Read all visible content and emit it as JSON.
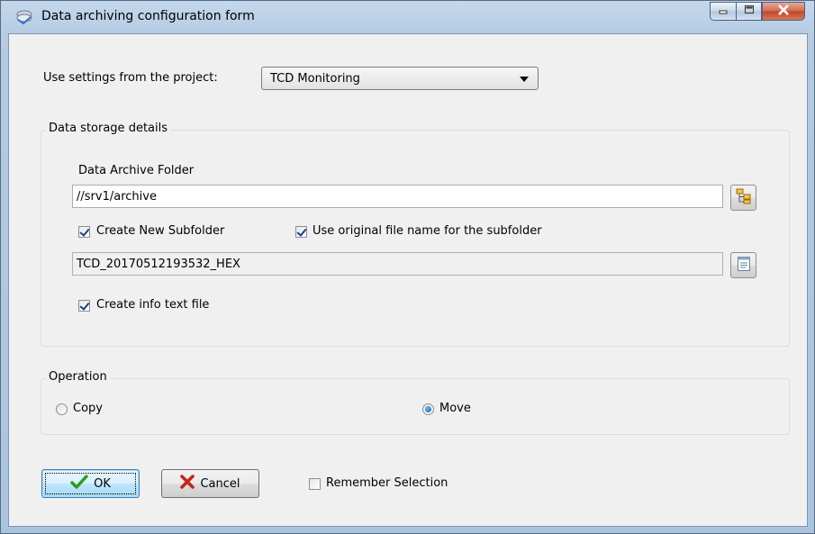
{
  "window": {
    "title": "Data archiving configuration form"
  },
  "project": {
    "label": "Use settings from the project:",
    "selected": "TCD Monitoring"
  },
  "storage": {
    "group_title": "Data storage details",
    "folder_label": "Data Archive Folder",
    "folder_value": "//srv1/archive",
    "create_subfolder_label": "Create New Subfolder",
    "create_subfolder_checked": true,
    "use_original_label": "Use original file name for the subfolder",
    "use_original_checked": true,
    "subfolder_value": "TCD_20170512193532_HEX",
    "create_info_label": "Create info text file",
    "create_info_checked": true
  },
  "operation": {
    "group_title": "Operation",
    "copy_label": "Copy",
    "move_label": "Move",
    "selected": "Move"
  },
  "buttons": {
    "ok_label": "OK",
    "cancel_label": "Cancel"
  },
  "remember": {
    "label": "Remember Selection",
    "checked": false
  },
  "icons": [
    "app-icon",
    "minimize-icon",
    "maximize-icon",
    "close-icon",
    "folder-tree-icon",
    "text-file-icon",
    "checkmark-icon",
    "x-icon"
  ],
  "colors": {
    "ok_check": "#2e9a1e",
    "cancel_x": "#c4251c",
    "close_button": "#c94b2f"
  }
}
